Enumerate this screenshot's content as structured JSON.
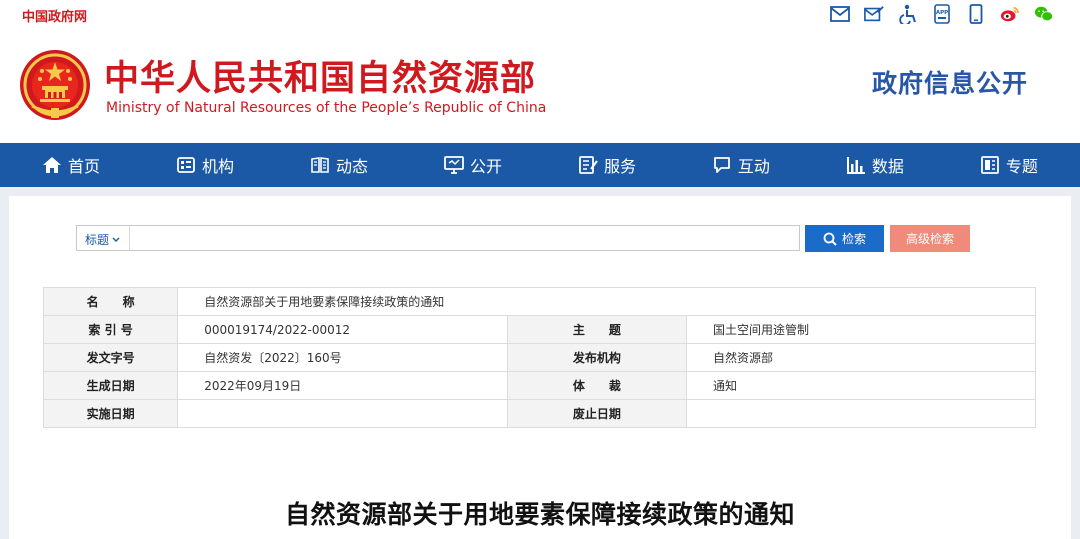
{
  "topbar": {
    "gov_link": "中国政府网",
    "icons": [
      "mail-icon",
      "mail-edit-icon",
      "accessibility-icon",
      "app-icon",
      "mobile-icon",
      "weibo-icon",
      "wechat-icon"
    ]
  },
  "header": {
    "title_cn": "中华人民共和国自然资源部",
    "title_en": "Ministry of Natural Resources of the People’s Republic of China",
    "section": "政府信息公开"
  },
  "nav": {
    "items": [
      {
        "label": "首页",
        "icon": "home-icon"
      },
      {
        "label": "机构",
        "icon": "org-icon"
      },
      {
        "label": "动态",
        "icon": "news-icon"
      },
      {
        "label": "公开",
        "icon": "disclosure-icon"
      },
      {
        "label": "服务",
        "icon": "service-icon"
      },
      {
        "label": "互动",
        "icon": "chat-icon"
      },
      {
        "label": "数据",
        "icon": "chart-icon"
      },
      {
        "label": "专题",
        "icon": "topic-icon"
      }
    ]
  },
  "search": {
    "field": "标题",
    "placeholder": "",
    "search_label": "检索",
    "advanced_label": "高级检索"
  },
  "info": {
    "name_key": "名　　称",
    "name_val": "自然资源部关于用地要素保障接续政策的通知",
    "index_key": "索 引 号",
    "index_val": "000019174/2022-00012",
    "subject_key": "主　　题",
    "subject_val": "国土空间用途管制",
    "docno_key": "发文字号",
    "docno_val": "自然资发〔2022〕160号",
    "issuer_key": "发布机构",
    "issuer_val": "自然资源部",
    "date_key": "生成日期",
    "date_val": "2022年09月19日",
    "genre_key": "体　　裁",
    "genre_val": "通知",
    "effective_key": "实施日期",
    "effective_val": "",
    "expire_key": "废止日期",
    "expire_val": ""
  },
  "document": {
    "title": "自然资源部关于用地要素保障接续政策的通知"
  },
  "colors": {
    "brand_red": "#d0191e",
    "nav_blue": "#1b59a6",
    "search_blue": "#1b6cc8",
    "advanced_salmon": "#f08a7a"
  }
}
